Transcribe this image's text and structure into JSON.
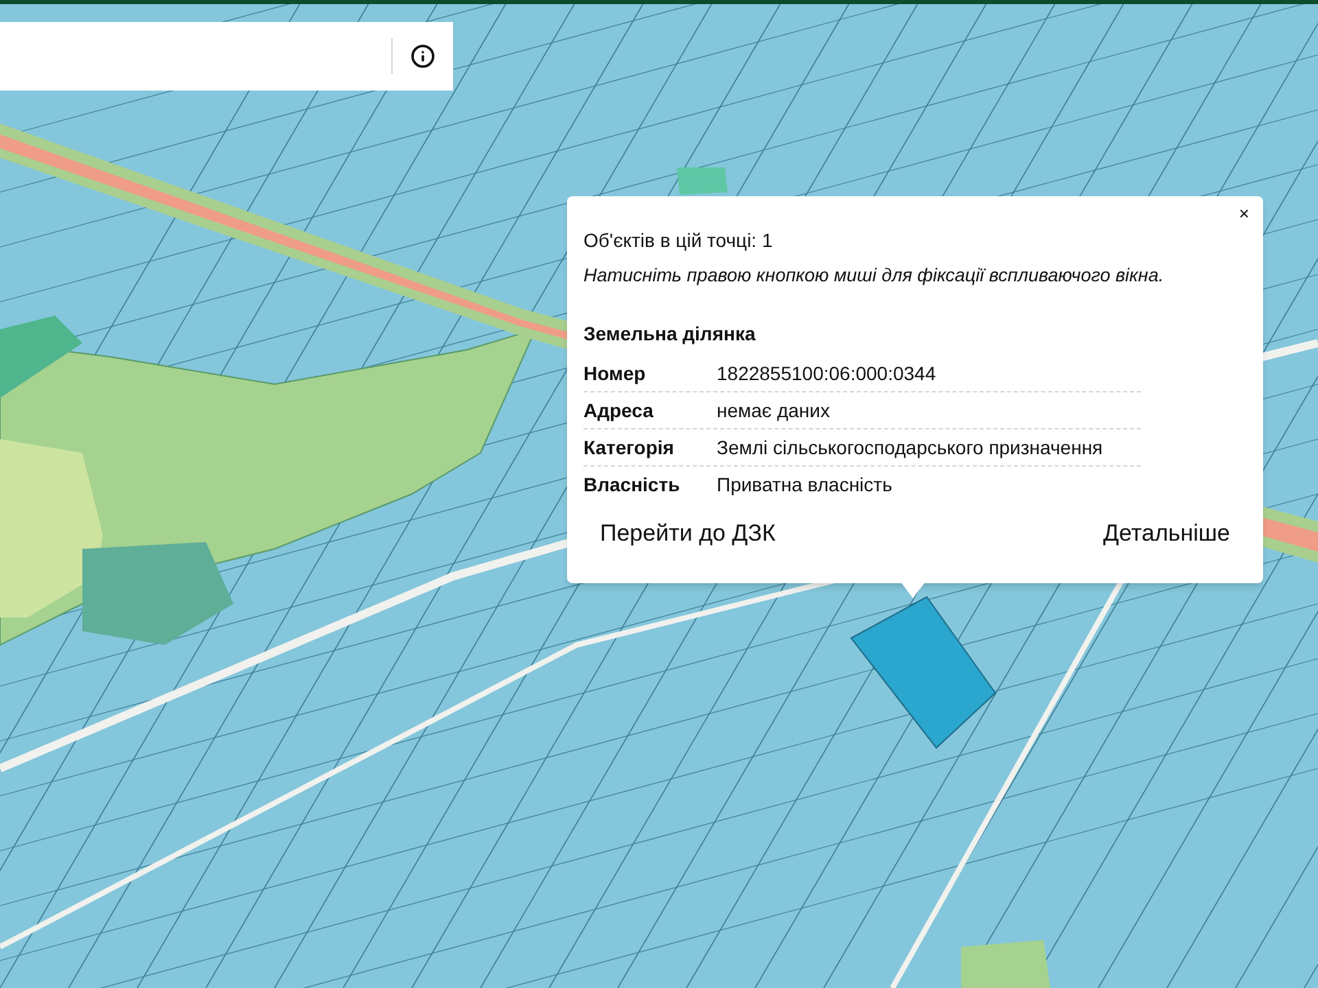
{
  "popup": {
    "count_text": "Об'єктів в цій точці: 1",
    "hint": "Натисніть правою кнопкою миші для фіксації вспливаючого вікна.",
    "close": "×",
    "section_title": "Земельна ділянка",
    "rows": [
      {
        "label": "Номер",
        "value": "1822855100:06:000:0344"
      },
      {
        "label": "Адреса",
        "value": "немає даних"
      },
      {
        "label": "Категорія",
        "value": "Землі сільськогосподарського призначення"
      },
      {
        "label": "Власність",
        "value": "Приватна власність"
      }
    ],
    "buttons": [
      {
        "label": "Перейти до ДЗК"
      },
      {
        "label": "Детальніше"
      }
    ]
  }
}
